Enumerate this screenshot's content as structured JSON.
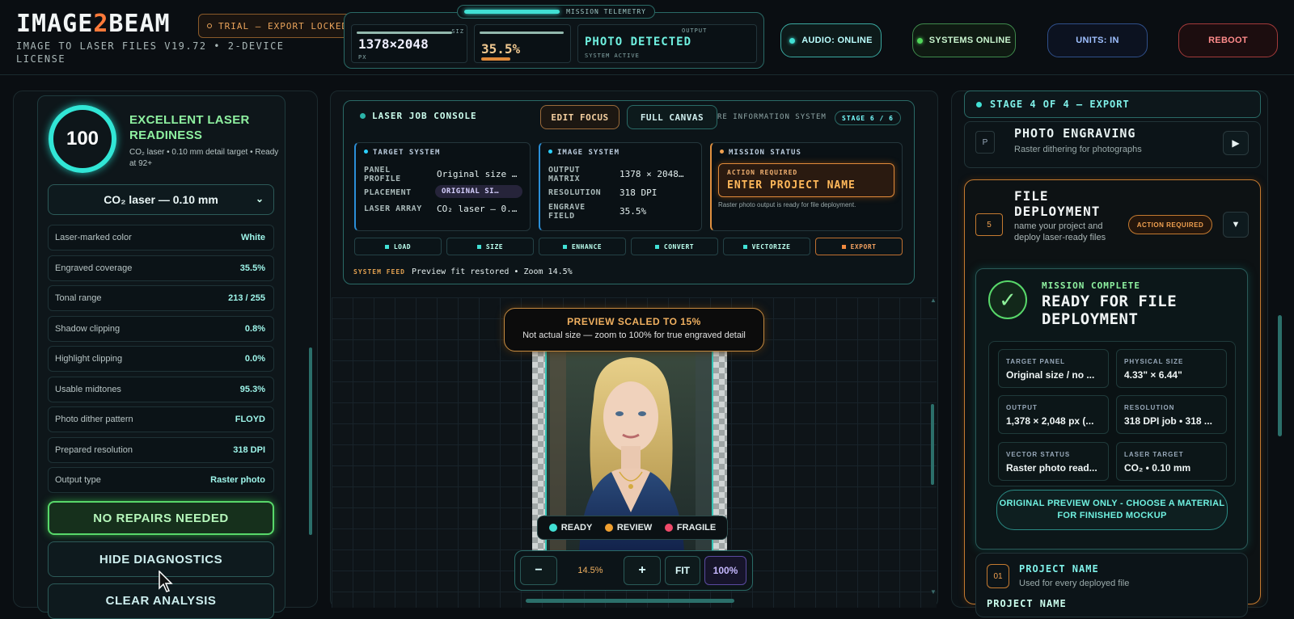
{
  "header": {
    "brand_pre": "IMAGE",
    "brand_mid": "2",
    "brand_post": "BEAM",
    "subtitle": "IMAGE TO LASER FILES V19.72 • 2-DEVICE LICENSE",
    "trial_badge": "TRIAL — EXPORT LOCKED",
    "telemetry": {
      "label": "MISSION TELEMETRY",
      "size_caption": "SIZ",
      "size_value": "1378×2048",
      "size_unit": "PX",
      "coverage_value": "35.5%",
      "output_caption": "OUTPUT",
      "output_value": "PHOTO DETECTED",
      "output_status": "SYSTEM ACTIVE"
    },
    "audio": "AUDIO: ONLINE",
    "systems": "SYSTEMS ONLINE",
    "units": "UNITS: IN",
    "reboot": "REBOOT"
  },
  "left": {
    "score": "100",
    "readiness_title": "EXCELLENT LASER READINESS",
    "readiness_desc": "CO₂ laser • 0.10 mm detail target • Ready at 92+",
    "laser_select": "CO₂ laser — 0.10 mm",
    "stats": [
      {
        "label": "Laser-marked color",
        "value": "White"
      },
      {
        "label": "Engraved coverage",
        "value": "35.5%"
      },
      {
        "label": "Tonal range",
        "value": "213 / 255"
      },
      {
        "label": "Shadow clipping",
        "value": "0.8%"
      },
      {
        "label": "Highlight clipping",
        "value": "0.0%"
      },
      {
        "label": "Usable midtones",
        "value": "95.3%"
      },
      {
        "label": "Photo dither pattern",
        "value": "FLOYD"
      },
      {
        "label": "Prepared resolution",
        "value": "318 DPI"
      },
      {
        "label": "Output type",
        "value": "Raster photo"
      }
    ],
    "no_repairs": "NO REPAIRS NEEDED",
    "hide_diag": "HIDE DIAGNOSTICS",
    "clear_analysis": "CLEAR ANALYSIS"
  },
  "console": {
    "title": "LASER JOB CONSOLE",
    "edit_focus": "EDIT FOCUS",
    "full_canvas": "FULL CANVAS",
    "info_system": "RE INFORMATION SYSTEM",
    "stage": "STAGE 6 / 6",
    "target": {
      "title": "TARGET SYSTEM",
      "k1": "PANEL PROFILE",
      "v1": "Original size …",
      "k2": "PLACEMENT",
      "v2": "ORIGINAL SI…",
      "k3": "LASER ARRAY",
      "v3": "CO₂ laser — 0.…"
    },
    "image": {
      "title": "IMAGE SYSTEM",
      "k1": "OUTPUT MATRIX",
      "v1": "1378 × 2048…",
      "k2": "RESOLUTION",
      "v2": "318 DPI",
      "k3": "ENGRAVE FIELD",
      "v3": "35.5%"
    },
    "mission": {
      "title": "MISSION STATUS",
      "action_label": "ACTION REQUIRED",
      "action_text": "ENTER PROJECT NAME",
      "note": "Raster photo output is ready for file deployment."
    },
    "steps": [
      "LOAD",
      "SIZE",
      "ENHANCE",
      "CONVERT",
      "VECTORIZE",
      "EXPORT"
    ],
    "feed_label": "SYSTEM FEED",
    "feed_text": "Preview fit restored • Zoom 14.5%"
  },
  "preview": {
    "banner_title": "PREVIEW SCALED TO 15%",
    "banner_sub": "Not actual size — zoom to 100% for true engraved detail",
    "legend": [
      {
        "label": "READY",
        "color": "#41e0d4"
      },
      {
        "label": "REVIEW",
        "color": "#f0a030"
      },
      {
        "label": "FRAGILE",
        "color": "#f04a6a"
      }
    ],
    "zoom_minus": "−",
    "zoom_value": "14.5%",
    "zoom_plus": "+",
    "fit": "FIT",
    "hundred": "100%"
  },
  "right": {
    "stage": "STAGE 4 OF 4 — EXPORT",
    "photo_badge": "P",
    "photo_title": "PHOTO ENGRAVING",
    "photo_sub": "Raster dithering for photographs",
    "deploy_num": "5",
    "deploy_title": "FILE DEPLOYMENT",
    "deploy_sub": "name your project and deploy laser-ready files",
    "deploy_action": "ACTION REQUIRED",
    "mission_small": "MISSION COMPLETE",
    "mission_big": "READY FOR FILE DEPLOYMENT",
    "cells": [
      {
        "label": "TARGET PANEL",
        "value": "Original size / no ..."
      },
      {
        "label": "PHYSICAL SIZE",
        "value": "4.33\" × 6.44\""
      },
      {
        "label": "OUTPUT",
        "value": "1,378 × 2,048 px (..."
      },
      {
        "label": "RESOLUTION",
        "value": "318 DPI job • 318 ..."
      },
      {
        "label": "VECTOR STATUS",
        "value": "Raster photo read..."
      },
      {
        "label": "LASER TARGET",
        "value": "CO₂ • 0.10 mm"
      }
    ],
    "orig_preview": "ORIGINAL PREVIEW ONLY - CHOOSE A MATERIAL FOR FINISHED MOCKUP",
    "proj_num": "01",
    "proj_title": "PROJECT NAME",
    "proj_sub": "Used for every deployed file",
    "proj_cut": "PROJECT NAME"
  }
}
